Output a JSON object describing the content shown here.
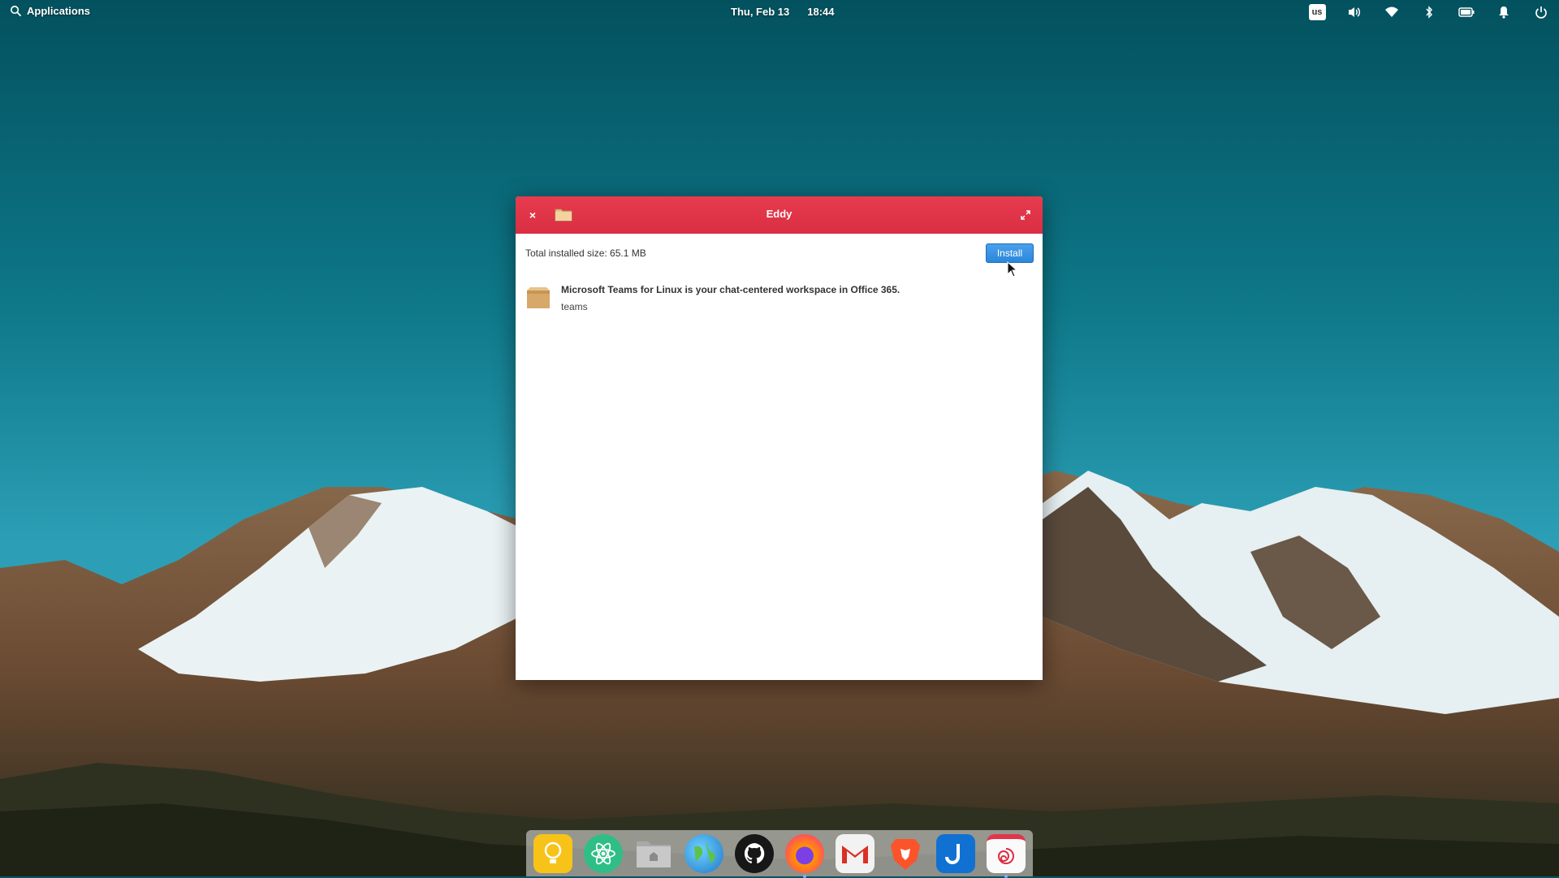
{
  "panel": {
    "applications_label": "Applications",
    "date": "Thu, Feb 13",
    "time": "18:44",
    "keyboard_layout": "us",
    "indicators": [
      "volume-icon",
      "wifi-icon",
      "bluetooth-icon",
      "battery-icon",
      "notification-bell-icon",
      "power-icon"
    ]
  },
  "window": {
    "title": "Eddy",
    "close_symbol": "×",
    "total_installed_size": "Total installed size: 65.1 MB",
    "install_label": "Install",
    "package": {
      "description": "Microsoft Teams for Linux is your chat-centered workspace in Office 365.",
      "name": "teams"
    },
    "titlebar_color": "#e0354a"
  },
  "dock": {
    "items": [
      "ideas-app-icon",
      "atom-icon",
      "files-icon",
      "web-browser-icon",
      "github-icon",
      "firefox-icon",
      "gmail-icon",
      "brave-icon",
      "joplin-icon",
      "eddy-icon"
    ]
  }
}
